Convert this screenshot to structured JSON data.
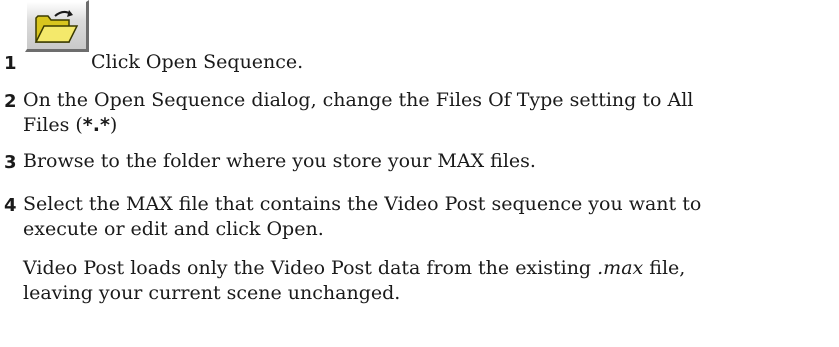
{
  "steps": [
    {
      "number": "1",
      "text": "Click Open Sequence.",
      "icon": "open-folder-icon"
    },
    {
      "number": "2",
      "text_line1": "On the Open Sequence dialog, change the Files Of Type setting to All",
      "text_line2_pre": "Files (",
      "text_line2_bold": "*.*",
      "text_line2_post": ")"
    },
    {
      "number": "3",
      "text": "Browse to the folder where you store your MAX files."
    },
    {
      "number": "4",
      "text_line1": "Select the MAX file that contains the Video Post sequence you want to",
      "text_line2": "execute or edit and click Open."
    }
  ],
  "note": {
    "line1_pre": "Video Post loads only the Video Post data from the existing ",
    "line1_italic": ".max",
    "line1_post": " file,",
    "line2": "leaving your current scene unchanged."
  }
}
